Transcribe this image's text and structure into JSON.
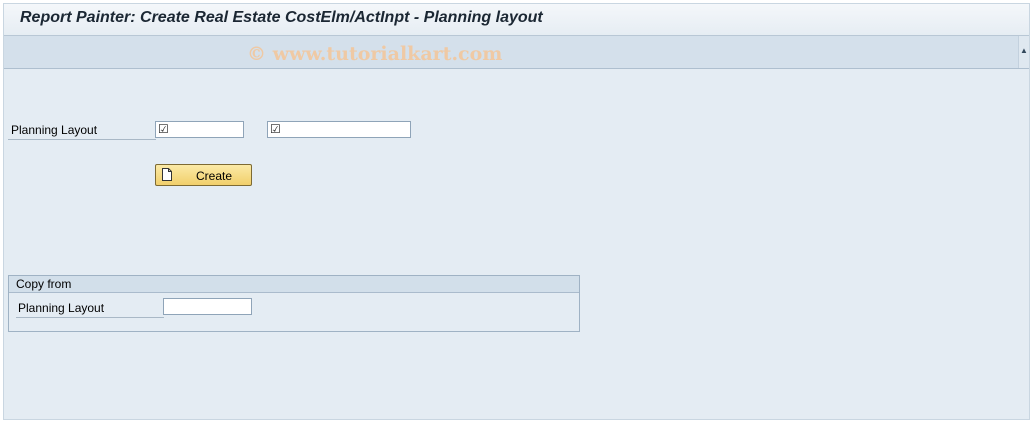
{
  "window": {
    "title": "Report Painter: Create Real Estate CostElm/ActInpt - Planning layout",
    "watermark": "© www.tutorialkart.com"
  },
  "form": {
    "planning_layout_label": "Planning Layout",
    "field1_value": "",
    "field2_value": "",
    "required_marker": "☑",
    "create_button_label": "Create"
  },
  "copy_from": {
    "title": "Copy from",
    "planning_layout_label": "Planning Layout",
    "value": ""
  },
  "icons": {
    "required": "required-field-icon",
    "create": "document-icon",
    "scroll": "scroll-up-icon"
  }
}
